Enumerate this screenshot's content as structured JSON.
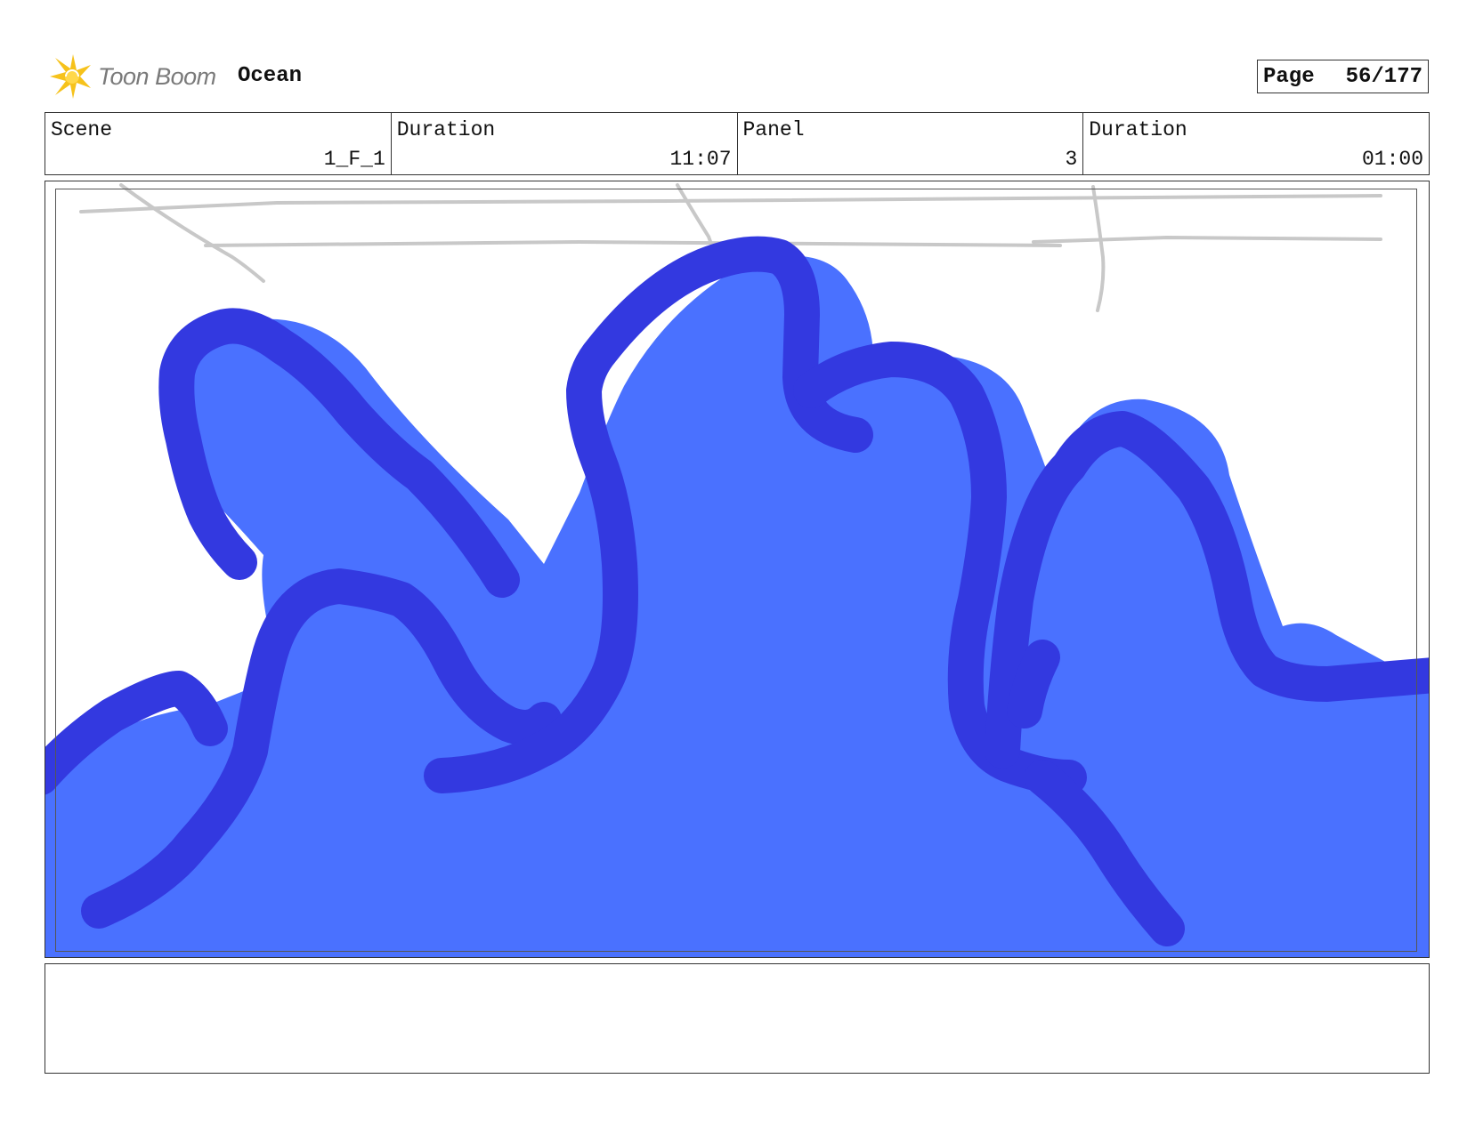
{
  "header": {
    "logo_text": "Toon Boom",
    "project_title": "Ocean",
    "page_label": "Page",
    "page_number": "56/177"
  },
  "info": {
    "scene_label": "Scene",
    "scene_value": "1_F_1",
    "scene_duration_label": "Duration",
    "scene_duration_value": "11:07",
    "panel_label": "Panel",
    "panel_value": "3",
    "panel_duration_label": "Duration",
    "panel_duration_value": "01:00"
  },
  "colors": {
    "wave_fill": "#4a71ff",
    "wave_stroke": "#3339e0",
    "sketch_line": "#c8c8c8",
    "logo_star": "#f6c21b"
  },
  "icons": [
    "toon-boom-star-icon"
  ]
}
